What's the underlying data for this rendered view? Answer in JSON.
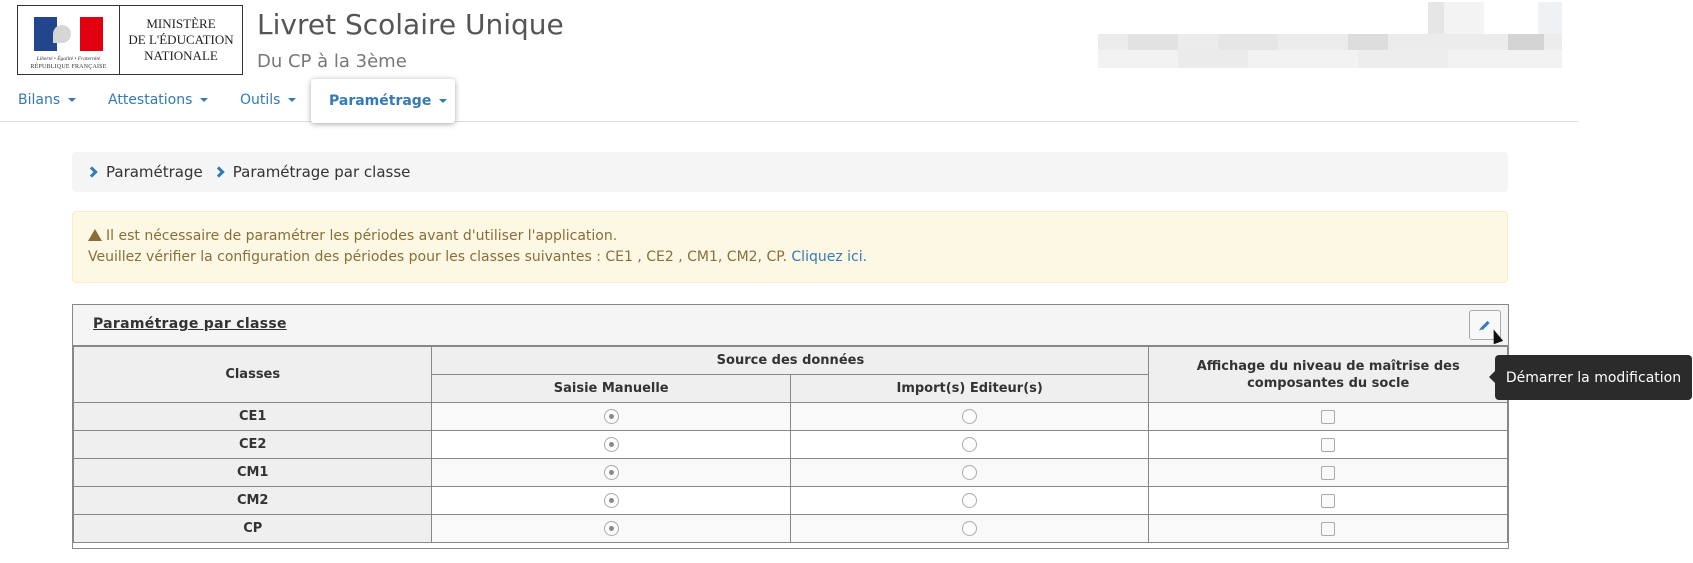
{
  "header": {
    "logo_line1": "MINISTÈRE",
    "logo_line2": "DE L'ÉDUCATION",
    "logo_line3": "NATIONALE",
    "logo_motto": "Liberté • Égalité • Fraternité",
    "logo_republic": "RÉPUBLIQUE FRANÇAISE",
    "title": "Livret Scolaire Unique",
    "subtitle": "Du CP à la 3ème"
  },
  "nav": {
    "items": [
      {
        "label": "Bilans"
      },
      {
        "label": "Attestations"
      },
      {
        "label": "Outils"
      },
      {
        "label": "Paramétrage"
      }
    ],
    "active": "Paramétrage"
  },
  "breadcrumb": [
    "Paramétrage",
    "Paramétrage par classe"
  ],
  "alert": {
    "line1": "Il est nécessaire de paramétrer les périodes avant d'utiliser l'application.",
    "line2": "Veuillez vérifier la configuration des périodes pour les classes suivantes : CE1 , CE2 , CM1, CM2, CP.",
    "link": "Cliquez ici."
  },
  "panel": {
    "title": "Paramétrage par classe",
    "edit_tooltip": "Démarrer la modification",
    "table": {
      "col_classes": "Classes",
      "col_source": "Source des données",
      "col_manual": "Saisie Manuelle",
      "col_import": "Import(s) Editeur(s)",
      "col_display": "Affichage du niveau de maîtrise des composantes du socle",
      "rows": [
        {
          "class": "CE1",
          "manual": true,
          "import": false,
          "display": false
        },
        {
          "class": "CE2",
          "manual": true,
          "import": false,
          "display": false
        },
        {
          "class": "CM1",
          "manual": true,
          "import": false,
          "display": false
        },
        {
          "class": "CM2",
          "manual": true,
          "import": false,
          "display": false
        },
        {
          "class": "CP",
          "manual": true,
          "import": false,
          "display": false
        }
      ]
    }
  },
  "colors": {
    "link": "#337ab7",
    "alert_bg": "#fcf8e3",
    "alert_text": "#8a6d3b",
    "tooltip_bg": "#2b2b2b"
  }
}
